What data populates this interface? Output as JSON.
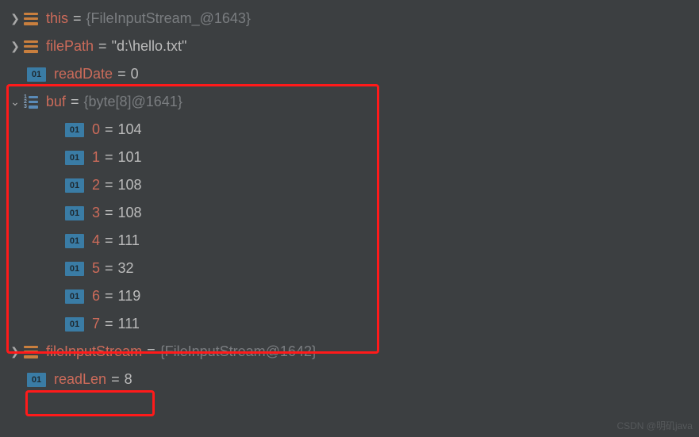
{
  "tree": {
    "this_name": "this",
    "this_val": "{FileInputStream_@1643}",
    "filePath_name": "filePath",
    "filePath_val": "\"d:\\hello.txt\"",
    "readDate_name": "readDate",
    "readDate_val": "0",
    "buf_name": "buf",
    "buf_val": "{byte[8]@1641}",
    "buf_items": [
      {
        "idx": "0",
        "val": "104"
      },
      {
        "idx": "1",
        "val": "101"
      },
      {
        "idx": "2",
        "val": "108"
      },
      {
        "idx": "3",
        "val": "108"
      },
      {
        "idx": "4",
        "val": "111"
      },
      {
        "idx": "5",
        "val": "32"
      },
      {
        "idx": "6",
        "val": "119"
      },
      {
        "idx": "7",
        "val": "111"
      }
    ],
    "fileInputStream_name": "fileInputStream",
    "fileInputStream_val": "{FileInputStream@1642}",
    "readLen_name": "readLen",
    "readLen_val": "8"
  },
  "icons": {
    "bin_label": "01"
  },
  "watermark": "CSDN @明矶java"
}
